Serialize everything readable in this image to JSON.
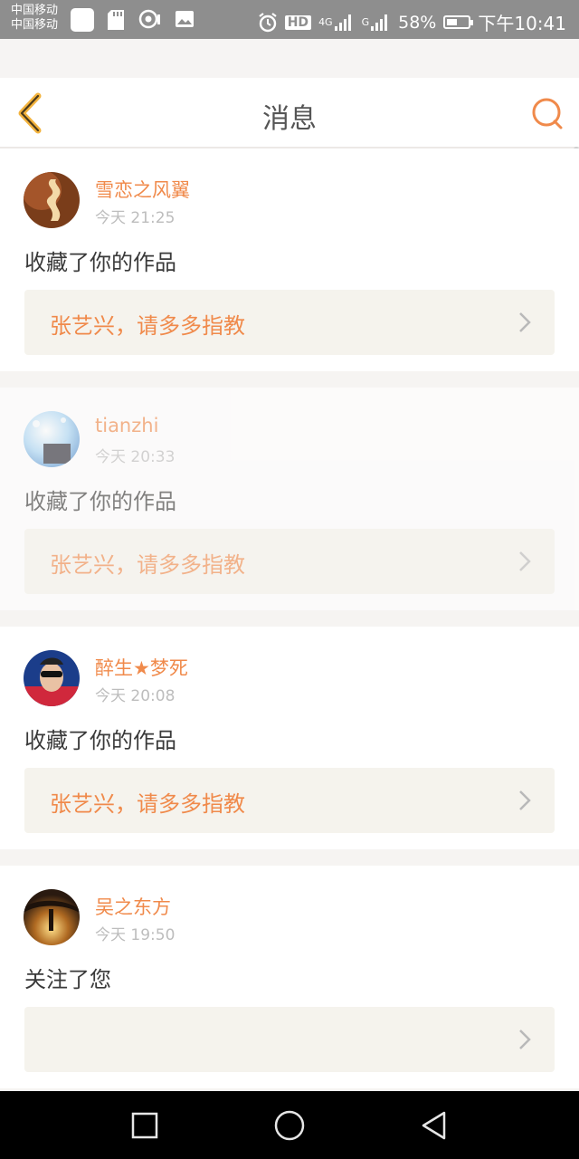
{
  "status_bar": {
    "carrier1": "中国移动",
    "carrier2": "中国移动",
    "hd": "HD",
    "net1": "4G",
    "net2": "G",
    "battery": "58%",
    "battery_level": 0.58,
    "time": "下午10:41"
  },
  "nav": {
    "title": "消息",
    "icons": {
      "back": "back-icon",
      "search": "search-icon"
    },
    "accent": "#f08a4b"
  },
  "messages": [
    {
      "user": "雪恋之风翼",
      "time": "今天 21:25",
      "action": "收藏了你的作品",
      "work": "张艺兴，请多多指教"
    },
    {
      "user": "tianzhi",
      "time": "今天 20:33",
      "action": "收藏了你的作品",
      "work": "张艺兴，请多多指教"
    },
    {
      "user": "醉生★梦死",
      "time": "今天 20:08",
      "action": "收藏了你的作品",
      "work": "张艺兴，请多多指教"
    },
    {
      "user": "吴之东方",
      "time": "今天 19:50",
      "action": "关注了您",
      "work": ""
    }
  ]
}
